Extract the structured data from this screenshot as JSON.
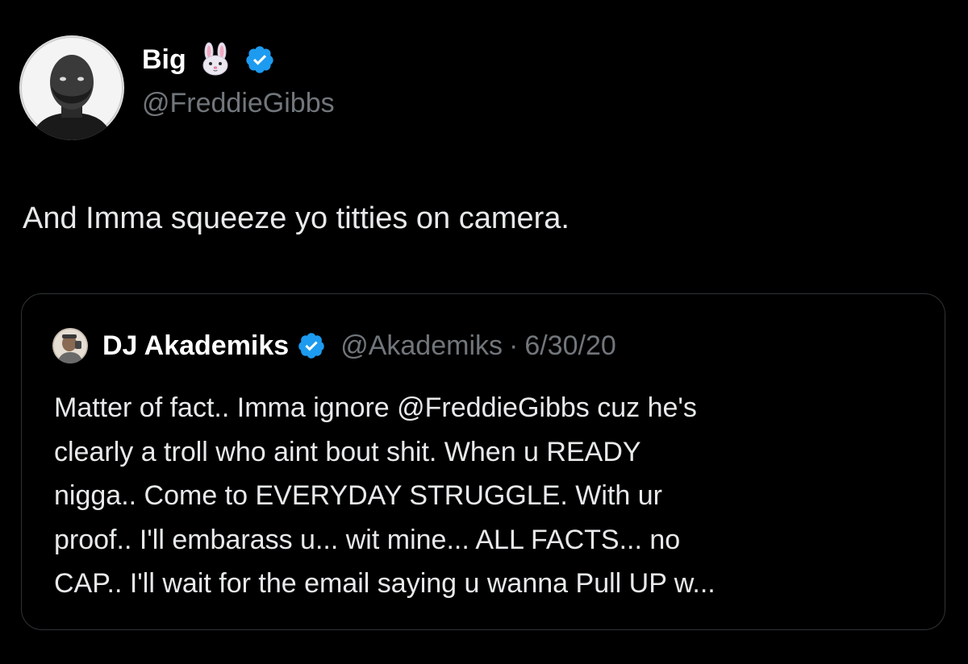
{
  "tweet": {
    "author": {
      "display_name": "Big",
      "emoji": "rabbit-face-emoji",
      "verified": true,
      "handle": "@FreddieGibbs"
    },
    "text": "And Imma squeeze yo titties on camera."
  },
  "quoted_tweet": {
    "author": {
      "display_name": "DJ Akademiks",
      "verified": true,
      "handle": "@Akademiks",
      "separator": "·",
      "date": "6/30/20"
    },
    "text_lines": [
      "Matter of fact.. Imma ignore @FreddieGibbs cuz he's",
      "clearly a troll who aint bout shit. When u READY",
      "nigga.. Come to EVERYDAY STRUGGLE. With ur",
      "proof.. I'll embarass u... wit mine... ALL FACTS... no",
      "CAP.. I'll wait for the email saying u wanna Pull UP w..."
    ]
  },
  "colors": {
    "background": "#000000",
    "primary_text": "#e7e9ea",
    "secondary_text": "#71767b",
    "verified_blue": "#1d9bf0",
    "card_border": "#2f3336"
  }
}
